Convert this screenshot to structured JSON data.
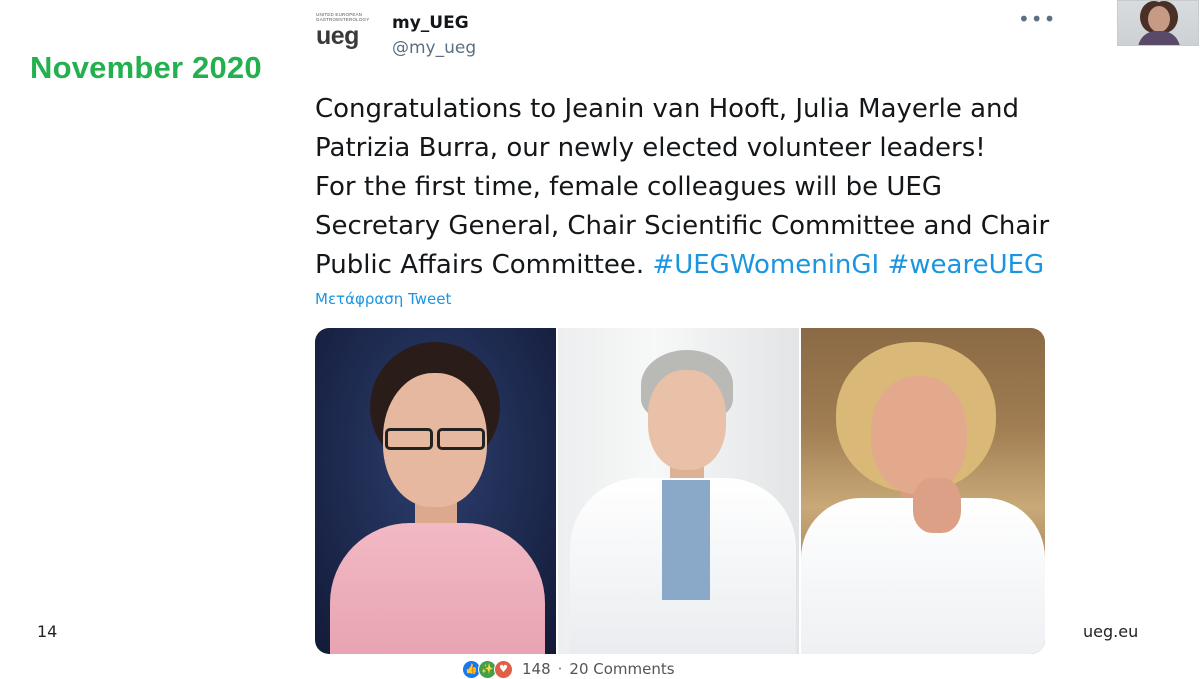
{
  "slide": {
    "title": "November 2020",
    "number": "14",
    "site": "ueg.eu"
  },
  "tweet": {
    "avatar": {
      "org_text": "UNITED EUROPEAN GASTROENTEROLOGY",
      "wordmark": "ueg"
    },
    "display_name": "my_UEG",
    "handle": "@my_ueg",
    "more_icon": "more-horizontal-icon",
    "text_lines": [
      "Congratulations to Jeanin van Hooft, Julia Mayerle and",
      "Patrizia Burra, our newly elected volunteer leaders!",
      "For the first time, female colleagues will be UEG",
      "Secretary General, Chair Scientific Committee and Chair"
    ],
    "last_line_text": "Public Affairs Committee.",
    "hashtags": [
      "#UEGWomeninGI",
      "#weareUEG"
    ],
    "translate_label": "Μετάφραση Tweet"
  },
  "reactions": {
    "icons": [
      "like-icon",
      "celebrate-icon",
      "love-icon"
    ],
    "count": "148",
    "separator": "·",
    "comments": "20 Comments"
  },
  "colors": {
    "title_green": "#23b04f",
    "hashtag_blue": "#1b95e0",
    "handle_gray": "#5b7083"
  }
}
